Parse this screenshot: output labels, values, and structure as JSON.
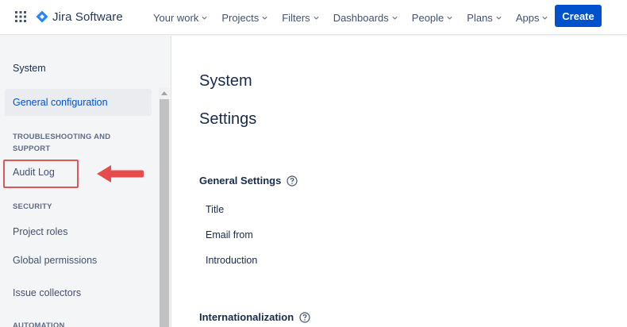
{
  "topnav": {
    "logo_text": "Jira Software",
    "items": [
      "Your work",
      "Projects",
      "Filters",
      "Dashboards",
      "People",
      "Plans",
      "Apps"
    ],
    "create_label": "Create"
  },
  "sidebar": {
    "heading": "System",
    "active_item": "General configuration",
    "sections": [
      {
        "title": "TROUBLESHOOTING AND SUPPORT",
        "items": [
          "Audit Log"
        ]
      },
      {
        "title": "SECURITY",
        "items": [
          "Project roles",
          "Global permissions",
          "Issue collectors"
        ]
      },
      {
        "title": "AUTOMATION",
        "items": []
      }
    ]
  },
  "main": {
    "title": "System",
    "subtitle": "Settings",
    "general_settings": {
      "title": "General Settings",
      "fields": [
        "Title",
        "Email from",
        "Introduction"
      ]
    },
    "internationalization": {
      "title": "Internationalization"
    }
  },
  "colors": {
    "brand": "#0052cc",
    "annotation": "#e05555"
  },
  "icons": {
    "app_switcher": "grid-icon",
    "logo": "jira-logo-icon",
    "help": "help-circle-icon",
    "annotation_arrow": "arrow-left-icon"
  }
}
